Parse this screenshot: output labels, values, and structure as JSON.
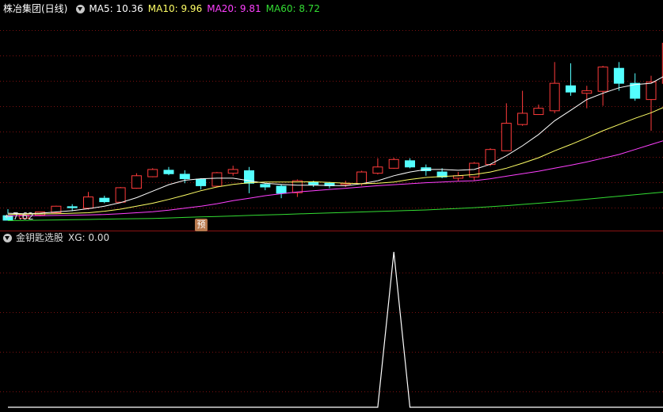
{
  "header": {
    "stock_name": "株冶集团(日线)",
    "ma5_label": "MA5: 10.36",
    "ma10_label": "MA10: 9.96",
    "ma20_label": "MA20: 9.81",
    "ma60_label": "MA60: 8.72"
  },
  "indicator": {
    "name": "金钥匙选股",
    "value_label": "XG: 0.00"
  },
  "markers": {
    "min_price_label": "←7.62",
    "forecast_badge": "预"
  },
  "colors": {
    "background": "#000000",
    "grid": "#7a1010",
    "up": "#ff3b3b",
    "down": "#54ffff",
    "ma5": "#ffffff",
    "ma10": "#ffff66",
    "ma20": "#ff40ff",
    "ma60": "#33dd33",
    "signal": "#ffffff"
  },
  "chart_data": [
    {
      "type": "candlestick",
      "series": [
        {
          "name": "K",
          "ohlc": [
            [
              7.8,
              7.62,
              8.06,
              7.88
            ],
            [
              7.7,
              7.82,
              7.88,
              7.65
            ],
            [
              7.82,
              7.95,
              7.96,
              7.78
            ],
            [
              7.92,
              8.18,
              8.2,
              7.9
            ],
            [
              8.16,
              8.12,
              8.26,
              7.98
            ],
            [
              8.1,
              8.55,
              8.75,
              8.05
            ],
            [
              8.5,
              8.36,
              8.6,
              8.3
            ],
            [
              8.34,
              8.92,
              8.95,
              8.3
            ],
            [
              8.9,
              9.4,
              9.5,
              8.88
            ],
            [
              9.36,
              9.65,
              9.7,
              9.34
            ],
            [
              9.62,
              9.48,
              9.75,
              9.42
            ],
            [
              9.46,
              9.28,
              9.62,
              9.1
            ],
            [
              9.26,
              9.0,
              9.3,
              8.85
            ],
            [
              8.98,
              9.52,
              9.55,
              8.94
            ],
            [
              9.5,
              9.65,
              9.8,
              9.4
            ],
            [
              9.6,
              9.1,
              9.75,
              8.7
            ],
            [
              9.05,
              8.95,
              9.1,
              8.82
            ],
            [
              8.98,
              8.7,
              9.05,
              8.5
            ],
            [
              8.72,
              9.2,
              9.25,
              8.55
            ],
            [
              9.15,
              9.05,
              9.2,
              8.95
            ],
            [
              9.1,
              9.0,
              9.15,
              8.9
            ],
            [
              9.05,
              9.1,
              9.2,
              8.95
            ],
            [
              9.08,
              9.55,
              9.6,
              9.0
            ],
            [
              9.5,
              9.75,
              10.1,
              9.45
            ],
            [
              9.7,
              10.05,
              10.12,
              9.68
            ],
            [
              10.0,
              9.75,
              10.1,
              9.7
            ],
            [
              9.72,
              9.6,
              9.85,
              9.4
            ],
            [
              9.55,
              9.35,
              9.7,
              9.3
            ],
            [
              9.3,
              9.4,
              9.55,
              9.2
            ],
            [
              9.35,
              9.9,
              9.95,
              9.2
            ],
            [
              9.85,
              10.45,
              10.5,
              9.78
            ],
            [
              10.4,
              11.5,
              12.3,
              10.4
            ],
            [
              11.45,
              11.9,
              12.8,
              11.4
            ],
            [
              11.85,
              12.1,
              12.25,
              11.85
            ],
            [
              12.0,
              13.1,
              13.95,
              11.9
            ],
            [
              13.0,
              12.75,
              13.9,
              12.6
            ],
            [
              12.7,
              12.8,
              13.0,
              12.1
            ],
            [
              12.78,
              13.75,
              13.8,
              12.2
            ],
            [
              13.7,
              13.1,
              13.95,
              12.8
            ],
            [
              13.1,
              12.5,
              13.5,
              12.4
            ],
            [
              12.45,
              13.15,
              13.4,
              11.2
            ],
            [
              13.1,
              14.7,
              14.95,
              12.5
            ],
            [
              14.65,
              14.5,
              14.8,
              14.2
            ],
            [
              14.48,
              14.35,
              14.7,
              14.1
            ],
            [
              14.3,
              13.65,
              14.5,
              13.45
            ],
            [
              13.7,
              13.8,
              14.4,
              13.5
            ],
            [
              13.75,
              13.45,
              14.0,
              13.4
            ],
            [
              13.5,
              13.8,
              13.95,
              13.4
            ],
            [
              13.7,
              13.35,
              14.0,
              13.2
            ]
          ]
        }
      ]
    },
    {
      "type": "line",
      "series": [
        {
          "name": "MA5",
          "values": [
            7.9,
            7.88,
            7.9,
            7.95,
            8.0,
            8.08,
            8.18,
            8.32,
            8.52,
            8.78,
            9.04,
            9.22,
            9.28,
            9.3,
            9.3,
            9.2,
            9.1,
            9.05,
            9.02,
            9.02,
            9.01,
            9.0,
            9.08,
            9.2,
            9.4,
            9.55,
            9.65,
            9.65,
            9.62,
            9.65,
            9.86,
            10.2,
            10.6,
            11.05,
            11.6,
            12.02,
            12.45,
            12.7,
            12.92,
            13.05,
            13.1,
            13.45,
            13.8,
            14.0,
            14.3,
            14.2,
            14.05,
            13.95,
            13.9
          ]
        },
        {
          "name": "MA10",
          "values": [
            7.85,
            7.86,
            7.87,
            7.88,
            7.9,
            7.92,
            7.98,
            8.06,
            8.18,
            8.3,
            8.45,
            8.62,
            8.8,
            8.95,
            9.05,
            9.12,
            9.15,
            9.15,
            9.15,
            9.16,
            9.13,
            9.1,
            9.08,
            9.1,
            9.15,
            9.25,
            9.33,
            9.37,
            9.4,
            9.45,
            9.55,
            9.7,
            9.9,
            10.12,
            10.4,
            10.65,
            10.92,
            11.2,
            11.45,
            11.7,
            11.92,
            12.2,
            12.5,
            12.8,
            13.05,
            13.3,
            13.55,
            13.7,
            13.85
          ]
        },
        {
          "name": "MA20",
          "values": [
            7.8,
            7.8,
            7.8,
            7.81,
            7.82,
            7.83,
            7.85,
            7.88,
            7.92,
            7.96,
            8.02,
            8.1,
            8.18,
            8.28,
            8.4,
            8.5,
            8.6,
            8.68,
            8.75,
            8.8,
            8.85,
            8.9,
            8.95,
            9.0,
            9.04,
            9.08,
            9.12,
            9.15,
            9.18,
            9.2,
            9.28,
            9.38,
            9.48,
            9.58,
            9.7,
            9.82,
            9.95,
            10.1,
            10.25,
            10.45,
            10.65,
            10.85,
            11.05,
            11.25,
            11.45,
            11.62,
            11.78,
            11.92,
            12.02
          ]
        },
        {
          "name": "MA60",
          "values": [
            7.6,
            7.61,
            7.62,
            7.63,
            7.64,
            7.65,
            7.66,
            7.67,
            7.68,
            7.69,
            7.71,
            7.73,
            7.75,
            7.77,
            7.79,
            7.81,
            7.83,
            7.85,
            7.87,
            7.89,
            7.91,
            7.93,
            7.95,
            7.97,
            7.99,
            8.01,
            8.03,
            8.06,
            8.09,
            8.12,
            8.16,
            8.2,
            8.25,
            8.3,
            8.35,
            8.4,
            8.46,
            8.52,
            8.58,
            8.64,
            8.7,
            8.76,
            8.82,
            8.88,
            8.94,
            9.0,
            9.05,
            9.1,
            9.14
          ]
        }
      ],
      "ylim": [
        7.3,
        15.8
      ]
    },
    {
      "type": "line",
      "series": [
        {
          "name": "XG",
          "values": [
            0,
            0,
            0,
            0,
            0,
            0,
            0,
            0,
            0,
            0,
            0,
            0,
            0,
            0,
            0,
            0,
            0,
            0,
            0,
            0,
            0,
            0,
            0,
            0,
            1,
            0,
            0,
            0,
            0,
            0,
            0,
            0,
            0,
            0,
            0,
            0,
            0,
            0,
            0,
            0,
            0
          ]
        }
      ],
      "ylim": [
        0,
        1.03
      ]
    }
  ]
}
